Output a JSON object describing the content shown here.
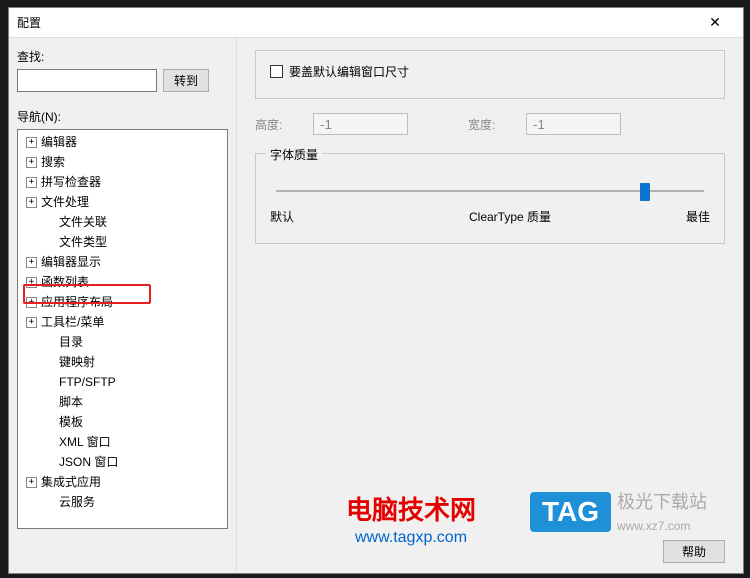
{
  "title": "配置",
  "find": {
    "label": "查找:",
    "goto": "转到"
  },
  "nav": {
    "label": "导航(N):",
    "items": [
      {
        "label": "编辑器",
        "exp": true,
        "indent": 1
      },
      {
        "label": "搜索",
        "exp": true,
        "indent": 1
      },
      {
        "label": "拼写检查器",
        "exp": true,
        "indent": 1
      },
      {
        "label": "文件处理",
        "exp": true,
        "indent": 1
      },
      {
        "label": "文件关联",
        "exp": false,
        "indent": 2
      },
      {
        "label": "文件类型",
        "exp": false,
        "indent": 2
      },
      {
        "label": "编辑器显示",
        "exp": true,
        "indent": 1
      },
      {
        "label": "函数列表",
        "exp": true,
        "indent": 1
      },
      {
        "label": "应用程序布局",
        "exp": true,
        "indent": 1,
        "hl": true
      },
      {
        "label": "工具栏/菜单",
        "exp": true,
        "indent": 1
      },
      {
        "label": "目录",
        "exp": false,
        "indent": 2
      },
      {
        "label": "键映射",
        "exp": false,
        "indent": 2
      },
      {
        "label": "FTP/SFTP",
        "exp": false,
        "indent": 2
      },
      {
        "label": "脚本",
        "exp": false,
        "indent": 2
      },
      {
        "label": "模板",
        "exp": false,
        "indent": 2
      },
      {
        "label": "XML 窗口",
        "exp": false,
        "indent": 2
      },
      {
        "label": "JSON 窗口",
        "exp": false,
        "indent": 2
      },
      {
        "label": "集成式应用",
        "exp": true,
        "indent": 1
      },
      {
        "label": "云服务",
        "exp": false,
        "indent": 2
      }
    ]
  },
  "override": {
    "checkbox_label": "要盖默认编辑窗口尺寸",
    "height_label": "高度:",
    "height_value": "-1",
    "width_label": "宽度:",
    "width_value": "-1"
  },
  "font_quality": {
    "title": "字体质量",
    "default_label": "默认",
    "cleartype_label": "ClearType 质量",
    "best_label": "最佳",
    "slider_percent": 85
  },
  "help_label": "帮助",
  "watermark": {
    "site1_a": "电脑技术网",
    "site1_b": "www.tagxp.com",
    "tag": "TAG",
    "side": "极光下载站",
    "side_url": "www.xz7.com"
  }
}
